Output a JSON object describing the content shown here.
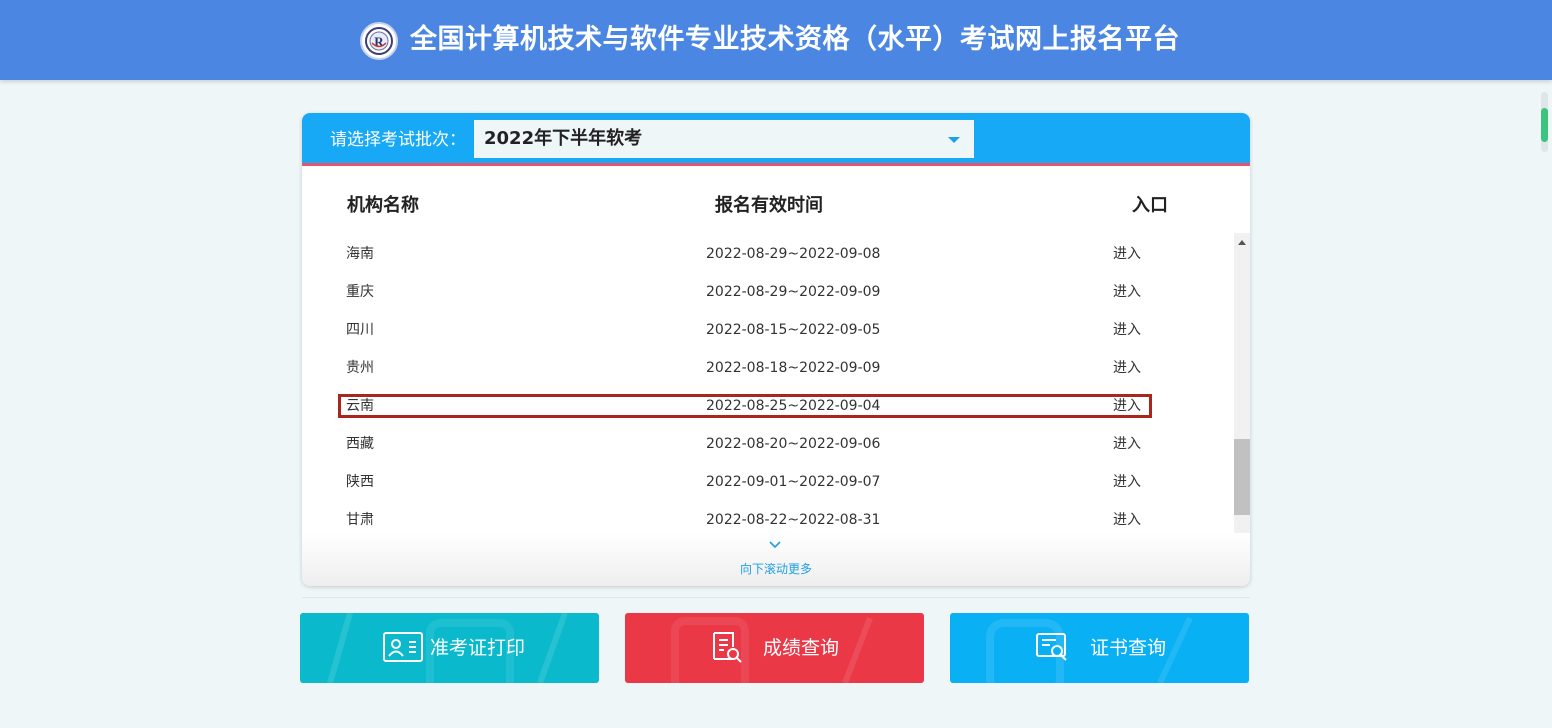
{
  "header": {
    "title": "全国计算机技术与软件专业技术资格（水平）考试网上报名平台",
    "logo_icon": "exam-seal-logo"
  },
  "batch": {
    "label": "请选择考试批次：",
    "selected": "2022年下半年软考"
  },
  "table": {
    "columns": [
      "机构名称",
      "报名有效时间",
      "入口"
    ],
    "rows": [
      {
        "name": "海南",
        "period": "2022-08-29~2022-09-08",
        "action": "进入"
      },
      {
        "name": "重庆",
        "period": "2022-08-29~2022-09-09",
        "action": "进入"
      },
      {
        "name": "四川",
        "period": "2022-08-15~2022-09-05",
        "action": "进入"
      },
      {
        "name": "贵州",
        "period": "2022-08-18~2022-09-09",
        "action": "进入"
      },
      {
        "name": "云南",
        "period": "2022-08-25~2022-09-04",
        "action": "进入"
      },
      {
        "name": "西藏",
        "period": "2022-08-20~2022-09-06",
        "action": "进入"
      },
      {
        "name": "陕西",
        "period": "2022-09-01~2022-09-07",
        "action": "进入"
      },
      {
        "name": "甘肃",
        "period": "2022-08-22~2022-08-31",
        "action": "进入"
      }
    ],
    "highlighted_row": "云南"
  },
  "scroll_more": {
    "label": "向下滚动更多",
    "icon": "chevron-down-icon"
  },
  "actions": [
    {
      "label": "准考证打印",
      "icon": "id-card-icon",
      "color": "#0abacc"
    },
    {
      "label": "成绩查询",
      "icon": "score-document-icon",
      "color": "#ea3847"
    },
    {
      "label": "证书查询",
      "icon": "certificate-search-icon",
      "color": "#0ab0f4"
    }
  ],
  "colors": {
    "header_bg": "#4a86e2",
    "card_header_bg": "#17a9f6",
    "accent_line": "#e8556a",
    "highlight_border": "#a8261b",
    "page_bg": "#eff6f8"
  }
}
